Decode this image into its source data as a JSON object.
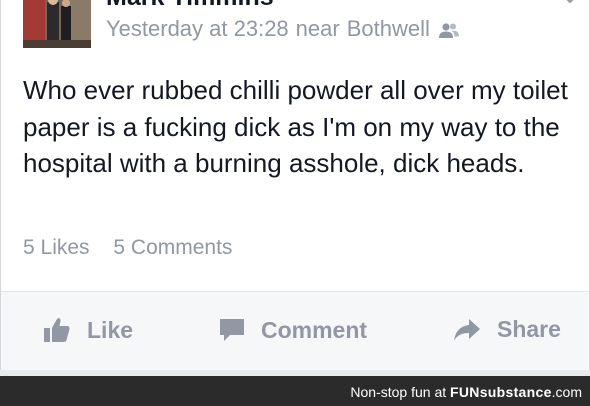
{
  "post": {
    "author": "Mark Timmins",
    "timestamp": "Yesterday at 23:28",
    "location_prefix": "near",
    "location": "Bothwell",
    "audience_icon": "friends-icon",
    "body": "Who ever rubbed chilli powder all over my toilet paper is a fucking dick as I'm on my way to the hospital with a burning asshole, dick heads.",
    "likes": "5 Likes",
    "comments": "5 Comments"
  },
  "actions": {
    "like": {
      "label": "Like",
      "icon": "thumbs-up-icon"
    },
    "comment": {
      "label": "Comment",
      "icon": "speech-bubble-icon"
    },
    "share": {
      "label": "Share",
      "icon": "share-arrow-icon"
    }
  },
  "watermark": {
    "prefix": "Non-stop fun at",
    "brand": "FUNsubstance",
    "domain": ".com"
  },
  "colors": {
    "text_primary": "#141823",
    "text_secondary": "#9197a3",
    "action_bar_bg": "#f6f7f9",
    "footer_bg": "#2b2b2b"
  }
}
